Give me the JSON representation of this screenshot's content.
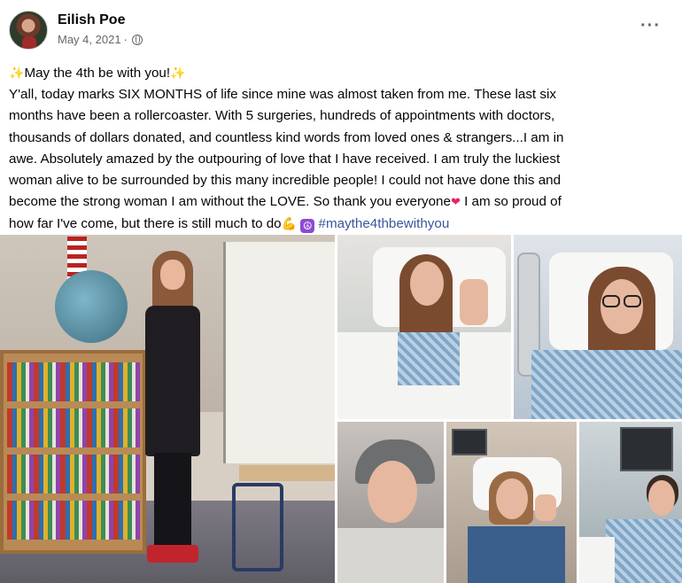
{
  "post": {
    "author": "Eilish Poe",
    "date": "May 4, 2021",
    "separator": "·",
    "more_label": "···",
    "text": {
      "line1": "May the 4th be with you!",
      "line2": "Y'all, today marks SIX MONTHS of life since mine was almost taken from me. These last six",
      "line3": "months have been a rollercoaster. With 5 surgeries, hundreds of appointments with doctors,",
      "line4": "thousands of dollars donated, and countless kind words from loved ones & strangers...I am in",
      "line5": "awe. Absolutely amazed by the outpouring of love that I have received. I am truly the luckiest",
      "line6": "woman alive to be surrounded by this many incredible people! I could not have done this and",
      "line7": "become the strong woman I am without the LOVE. So thank you everyone",
      "line7b": " I am so proud of",
      "line8": "how far I've come, but there is still much to do",
      "hashtag": "#maythe4thbewithyou"
    },
    "emoji": {
      "sparkle": "✨",
      "heart": "❤",
      "muscle": "💪",
      "peace": "☮"
    }
  },
  "icons": {
    "avatar": "avatar",
    "privacy": "globe-icon",
    "more": "more-options-icon"
  },
  "colors": {
    "text": "#050505",
    "meta": "#65676b",
    "hashtag": "#385898"
  }
}
